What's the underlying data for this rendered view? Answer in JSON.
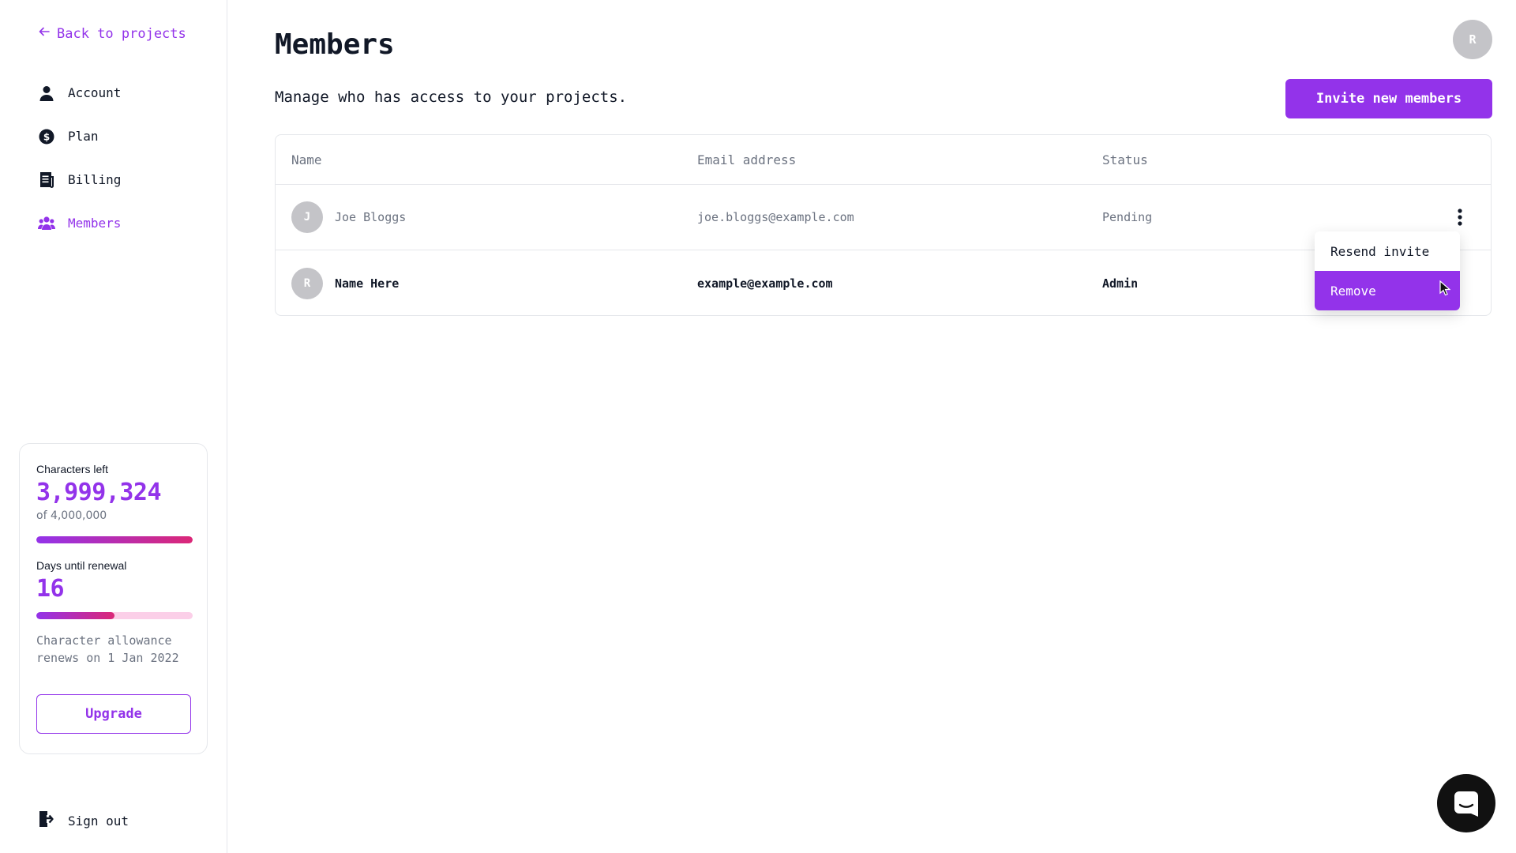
{
  "sidebar": {
    "back_label": "Back to projects",
    "items": [
      {
        "label": "Account",
        "icon": "user-icon"
      },
      {
        "label": "Plan",
        "icon": "dollar-circle-icon"
      },
      {
        "label": "Billing",
        "icon": "receipt-icon"
      },
      {
        "label": "Members",
        "icon": "users-icon",
        "active": true
      }
    ],
    "sign_out_label": "Sign out"
  },
  "usage": {
    "characters_label": "Characters left",
    "characters_value": "3,999,324",
    "characters_total": "of 4,000,000",
    "characters_progress": 0.9998,
    "days_label": "Days until renewal",
    "days_value": "16",
    "days_progress": 0.5,
    "renew_text": "Character allowance renews on 1 Jan 2022",
    "upgrade_label": "Upgrade"
  },
  "header": {
    "title": "Members",
    "description": "Manage who has access to your projects.",
    "invite_label": "Invite new members",
    "avatar_initial": "R"
  },
  "table": {
    "columns": [
      "Name",
      "Email address",
      "Status"
    ],
    "rows": [
      {
        "initial": "J",
        "name": "Joe Bloggs",
        "email": "joe.bloggs@example.com",
        "status": "Pending"
      },
      {
        "initial": "R",
        "name": "Name Here",
        "email": "example@example.com",
        "status": "Admin"
      }
    ]
  },
  "dropdown": {
    "items": [
      "Resend invite",
      "Remove"
    ],
    "highlighted": "Remove"
  },
  "colors": {
    "accent": "#9333ea",
    "accent_secondary": "#db2777",
    "muted": "#6b7280"
  },
  "widgets": {
    "chat_icon": "chat-bubble-icon"
  }
}
